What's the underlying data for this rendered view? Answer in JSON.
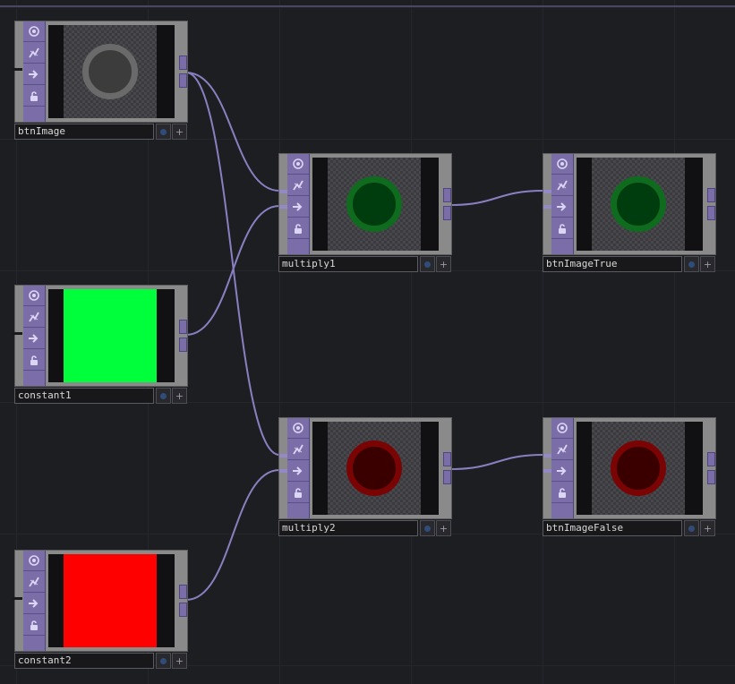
{
  "network": {
    "background_color": "#1d1e22",
    "wire_color": "#8a7fc0",
    "nodes": [
      {
        "id": "btnImage",
        "name": "btnImage",
        "preview": "ring",
        "ring_color": "#3c3c3c",
        "ring_border": "#6a6a6a"
      },
      {
        "id": "constant1",
        "name": "constant1",
        "preview": "solid",
        "fill_color": "#00ff3b"
      },
      {
        "id": "constant2",
        "name": "constant2",
        "preview": "solid",
        "fill_color": "#ff0000"
      },
      {
        "id": "multiply1",
        "name": "multiply1",
        "preview": "ring",
        "ring_color": "#003d0e",
        "ring_border": "#0f6b1e"
      },
      {
        "id": "multiply2",
        "name": "multiply2",
        "preview": "ring",
        "ring_color": "#3a0000",
        "ring_border": "#7a0404"
      },
      {
        "id": "btnImageTrue",
        "name": "btnImageTrue",
        "preview": "ring",
        "ring_color": "#003d0e",
        "ring_border": "#0f6b1e"
      },
      {
        "id": "btnImageFalse",
        "name": "btnImageFalse",
        "preview": "ring",
        "ring_color": "#3a0000",
        "ring_border": "#7a0404"
      }
    ],
    "connections": [
      {
        "from": "btnImage",
        "to": "multiply1",
        "input": 0
      },
      {
        "from": "btnImage",
        "to": "multiply2",
        "input": 0
      },
      {
        "from": "constant1",
        "to": "multiply1",
        "input": 1
      },
      {
        "from": "constant2",
        "to": "multiply2",
        "input": 1
      },
      {
        "from": "multiply1",
        "to": "btnImageTrue",
        "input": 0
      },
      {
        "from": "multiply2",
        "to": "btnImageFalse",
        "input": 0
      }
    ],
    "flag_icons": [
      "cook-flag-icon",
      "bypass-flag-icon",
      "display-flag-icon",
      "lock-flag-icon"
    ]
  }
}
